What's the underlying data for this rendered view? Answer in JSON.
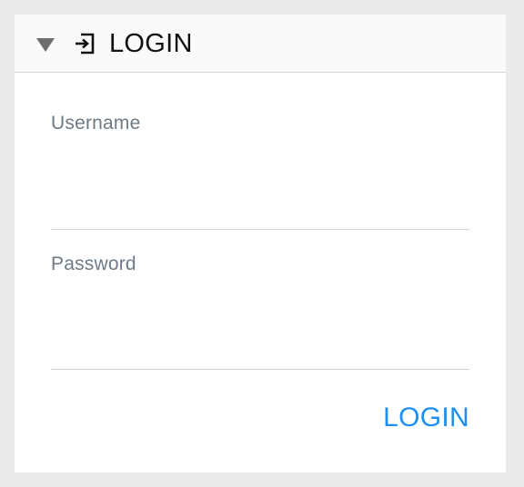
{
  "panel": {
    "title": "LOGIN",
    "toggle_icon": "caret-down-icon",
    "title_icon": "login-icon"
  },
  "form": {
    "username_label": "Username",
    "username_value": "",
    "password_label": "Password",
    "password_value": "",
    "submit_label": "LOGIN"
  },
  "colors": {
    "accent": "#1e8ff0",
    "label": "#6d7a87",
    "background": "#ebebeb",
    "panel": "#ffffff",
    "header": "#fafafa"
  }
}
